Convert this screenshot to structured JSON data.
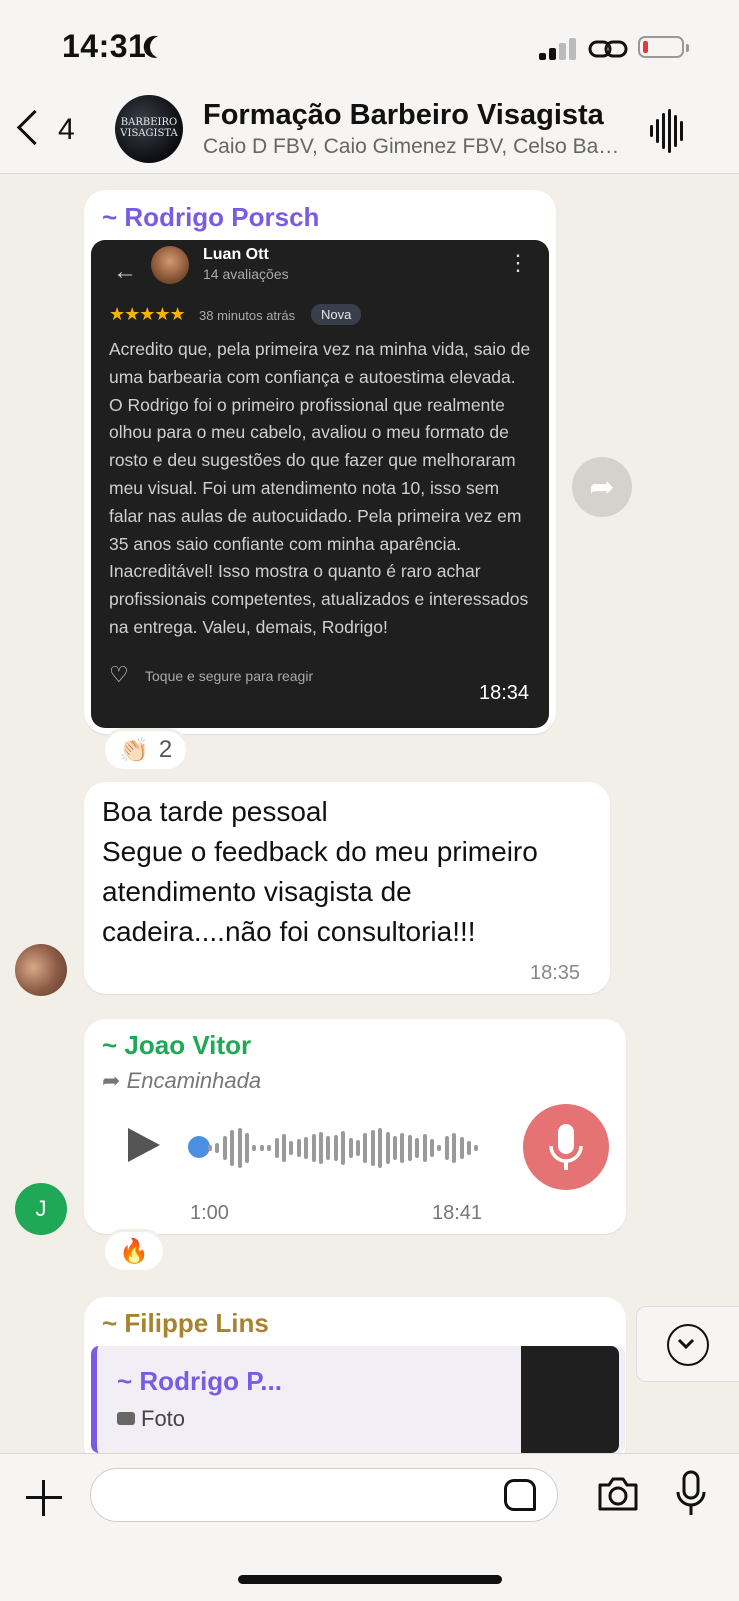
{
  "status_bar": {
    "time": "14:31"
  },
  "header": {
    "back_count": "4",
    "group_avatar_text": "BARBEIRO VISAGISTA",
    "title": "Formação Barbeiro Visagista",
    "members": "Caio D FBV, Caio Gimenez FBV, Celso Bastos, Diogo"
  },
  "messages": [
    {
      "sender": "~ Rodrigo Porsch",
      "sender_color": "#7a5ce0",
      "review": {
        "reviewer_name": "Luan Ott",
        "reviewer_count": "14 avaliações",
        "stars": "★★★★★",
        "time_ago": "38 minutos atrás",
        "badge": "Nova",
        "text": "Acredito que, pela primeira vez na minha vida, saio de uma barbearia com confiança e autoestima elevada. O Rodrigo foi o primeiro profissional que realmente olhou para o meu cabelo, avaliou o meu formato de rosto e deu sugestões do que fazer que melhoraram meu visual. Foi um atendimento nota 10, isso sem falar nas aulas de autocuidado. Pela primeira vez em 35 anos saio confiante com minha aparência. Inacreditável! Isso mostra o quanto é raro achar profissionais competentes, atualizados e interessados na entrega. Valeu, demais, Rodrigo!",
        "hint": "Toque e segure para reagir"
      },
      "time": "18:34",
      "reaction": {
        "emoji": "👏🏻",
        "count": "2"
      }
    },
    {
      "text_lines": [
        "Boa tarde pessoal",
        "Segue o feedback do meu primeiro",
        "atendimento visagista de",
        "cadeira....não foi consultoria!!!"
      ],
      "time": "18:35"
    },
    {
      "sender": "~ Joao Vitor",
      "sender_color": "#1fa855",
      "forwarded": "Encaminhada",
      "audio_duration": "1:00",
      "time": "18:41",
      "avatar_letter": "J",
      "avatar_color": "#1fa855",
      "reaction": {
        "emoji": "🔥"
      }
    },
    {
      "sender": "~ Filippe Lins",
      "sender_color": "#a88230",
      "quote_sender": "~ Rodrigo P...",
      "quote_sender_color": "#7a5ce0",
      "quote_text": "Foto"
    }
  ],
  "composer": {
    "placeholder": ""
  }
}
